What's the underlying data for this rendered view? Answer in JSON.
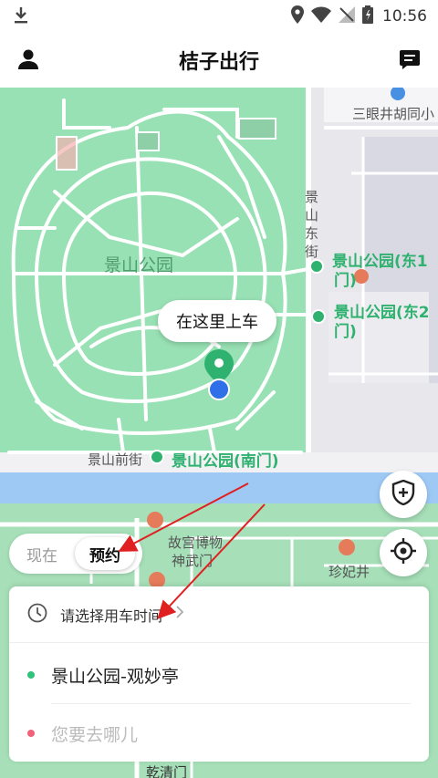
{
  "status_bar": {
    "time": "10:56"
  },
  "header": {
    "title": "桔子出行"
  },
  "map": {
    "labels": {
      "hutong": "三眼井胡同小",
      "park": "景山公园",
      "jingshan_east_st": "景山东街",
      "east1": "景山公园(东1",
      "east1_b": "门)",
      "east2": "景山公园(东2",
      "east2_b": "门)",
      "jingshan_front_st": "景山前街",
      "south_gate": "景山公园(南门)",
      "museum": "故宫博物",
      "shenwumen": "神武门",
      "zhenfei": "珍妃井",
      "qianqingmen": "乾清门"
    },
    "pickup_bubble": "在这里上车"
  },
  "time_toggle": {
    "now": "现在",
    "reserve": "预约",
    "active": "reserve"
  },
  "trip_card": {
    "time_prompt": "请选择用车时间",
    "origin": "景山公园-观妙亭",
    "destination_placeholder": "您要去哪儿"
  },
  "colors": {
    "map_green": "#98e1b4",
    "brand_green": "#2fb26f",
    "origin_dot": "#2fc27a",
    "destination_dot": "#f0617a",
    "annotation_red": "#e02020"
  },
  "icons": [
    "download-icon",
    "location-icon",
    "wifi-icon",
    "signal-icon",
    "battery-icon",
    "user-icon",
    "message-icon",
    "shield-plus-icon",
    "locate-icon",
    "clock-icon",
    "chevron-right-icon",
    "map-pin-icon"
  ]
}
